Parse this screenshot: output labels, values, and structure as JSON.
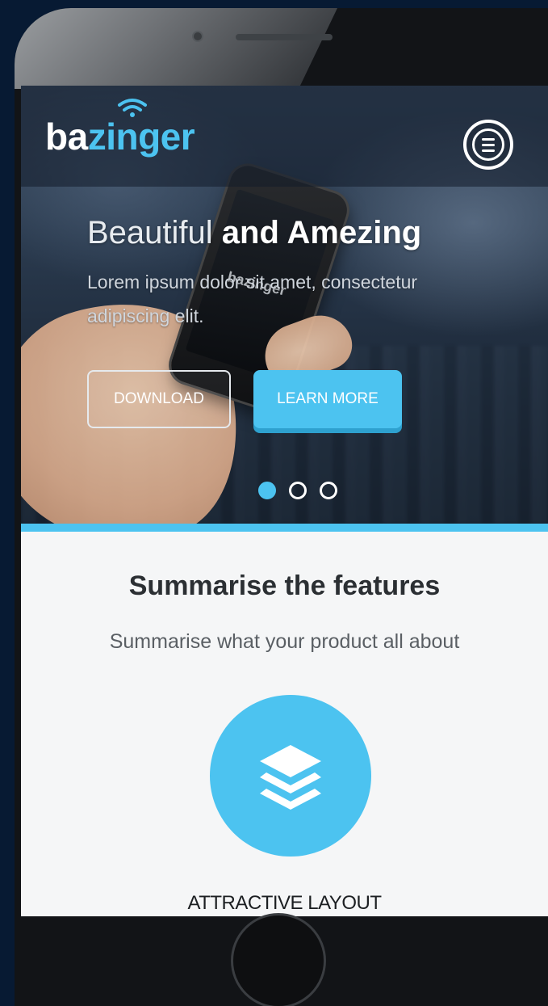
{
  "brand": {
    "name_part1": "ba",
    "name_part2": "zinger",
    "accent_color": "#4cc3f0"
  },
  "header": {
    "menu_icon": "hamburger-menu-icon"
  },
  "hero": {
    "title_light": "Beautiful ",
    "title_bold": "and Amezing",
    "subtitle": "Lorem ipsum dolor sit amet, consectetur adipiscing elit.",
    "held_phone_logo": "bazinger",
    "download_label": "DOWNLOAD",
    "learn_more_label": "LEARN MORE",
    "slides_total": 3,
    "slide_active": 1
  },
  "features": {
    "title": "Summarise the features",
    "subtitle": "Summarise what your product all about",
    "items": [
      {
        "icon": "layers-icon",
        "label": "ATTRACTIVE LAYOUT"
      }
    ]
  }
}
